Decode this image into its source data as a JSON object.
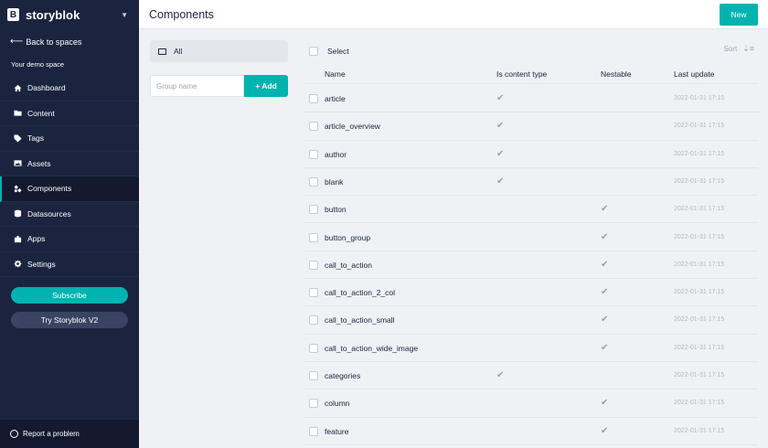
{
  "app": {
    "brand": "storyblok",
    "brand_logo_letter": "B",
    "back_link": "Back to spaces",
    "space_name": "Your demo space",
    "colors": {
      "sidebar": "#1b243f",
      "accent": "#00b3b0"
    }
  },
  "nav": [
    {
      "label": "Dashboard",
      "icon": "home-icon"
    },
    {
      "label": "Content",
      "icon": "folder-icon"
    },
    {
      "label": "Tags",
      "icon": "tag-icon"
    },
    {
      "label": "Assets",
      "icon": "image-icon"
    },
    {
      "label": "Components",
      "icon": "components-icon",
      "active": true
    },
    {
      "label": "Datasources",
      "icon": "database-icon"
    },
    {
      "label": "Apps",
      "icon": "puzzle-icon"
    },
    {
      "label": "Settings",
      "icon": "gear-icon"
    }
  ],
  "sidebar_buttons": {
    "subscribe": "Subscribe",
    "try_v2": "Try Storyblok V2"
  },
  "footer": {
    "report": "Report a problem"
  },
  "header": {
    "title": "Components",
    "new_button": "New"
  },
  "groups": {
    "all_label": "All",
    "input_placeholder": "Group name",
    "add_button": "+ Add"
  },
  "table": {
    "select_label": "Select",
    "sort_label": "Sort",
    "columns": {
      "name": "Name",
      "content_type": "Is content type",
      "nestable": "Nestable",
      "last_update": "Last update"
    },
    "rows": [
      {
        "name": "article",
        "content_type": true,
        "nestable": false,
        "date": "2022-01-31 17:15"
      },
      {
        "name": "article_overview",
        "content_type": true,
        "nestable": false,
        "date": "2022-01-31 17:15"
      },
      {
        "name": "author",
        "content_type": true,
        "nestable": false,
        "date": "2022-01-31 17:15"
      },
      {
        "name": "blank",
        "content_type": true,
        "nestable": false,
        "date": "2022-01-31 17:15"
      },
      {
        "name": "button",
        "content_type": false,
        "nestable": true,
        "date": "2022-01-31 17:15"
      },
      {
        "name": "button_group",
        "content_type": false,
        "nestable": true,
        "date": "2022-01-31 17:15"
      },
      {
        "name": "call_to_action",
        "content_type": false,
        "nestable": true,
        "date": "2022-01-31 17:15"
      },
      {
        "name": "call_to_action_2_col",
        "content_type": false,
        "nestable": true,
        "date": "2022-01-31 17:15"
      },
      {
        "name": "call_to_action_small",
        "content_type": false,
        "nestable": true,
        "date": "2022-01-31 17:15"
      },
      {
        "name": "call_to_action_wide_image",
        "content_type": false,
        "nestable": true,
        "date": "2022-01-31 17:15"
      },
      {
        "name": "categories",
        "content_type": true,
        "nestable": false,
        "date": "2022-01-31 17:15"
      },
      {
        "name": "column",
        "content_type": false,
        "nestable": true,
        "date": "2022-01-31 17:15"
      },
      {
        "name": "feature",
        "content_type": false,
        "nestable": true,
        "date": "2022-01-31 17:15"
      }
    ]
  }
}
